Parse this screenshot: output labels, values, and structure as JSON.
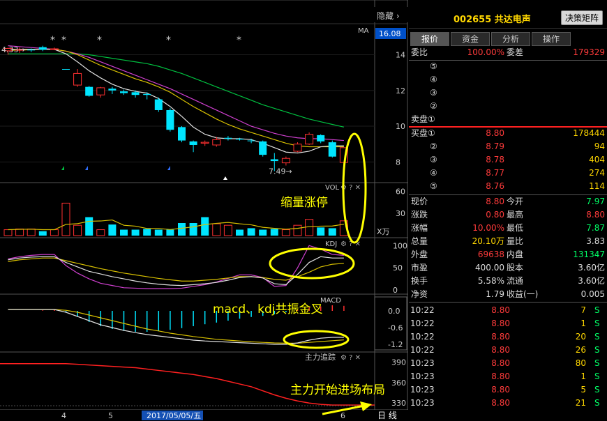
{
  "toolbar": {
    "hide_label": "隐藏",
    "hide_arrow": "›"
  },
  "stock": {
    "code_name": "002655 共达电声",
    "decision_button": "决策矩阵"
  },
  "tabs": [
    "报价",
    "资金",
    "分析",
    "操作"
  ],
  "quote": {
    "weibi_label": "委比",
    "weibi": "100.00%",
    "weicha_label": "委差",
    "weicha": "179329",
    "sell_header": "卖盘①",
    "sell_levels": [
      "⑤",
      "④",
      "③",
      "②"
    ],
    "buy_header": "买盘①",
    "buy": [
      {
        "level": "①",
        "price": "8.80",
        "vol": "178444"
      },
      {
        "level": "②",
        "price": "8.79",
        "vol": "94"
      },
      {
        "level": "③",
        "price": "8.78",
        "vol": "404"
      },
      {
        "level": "④",
        "price": "8.77",
        "vol": "274"
      },
      {
        "level": "⑤",
        "price": "8.76",
        "vol": "114"
      }
    ],
    "stats": [
      {
        "l1": "现价",
        "v1": "8.80",
        "c1": "red",
        "l2": "今开",
        "v2": "7.97",
        "c2": "grn"
      },
      {
        "l1": "涨跌",
        "v1": "0.80",
        "c1": "red",
        "l2": "最高",
        "v2": "8.80",
        "c2": "red"
      },
      {
        "l1": "涨幅",
        "v1": "10.00%",
        "c1": "red",
        "l2": "最低",
        "v2": "7.87",
        "c2": "grn"
      },
      {
        "l1": "总量",
        "v1": "20.10万",
        "c1": "yel",
        "l2": "量比",
        "v2": "3.83",
        "c2": "wht"
      },
      {
        "l1": "外盘",
        "v1": "69638",
        "c1": "red",
        "l2": "内盘",
        "v2": "131347",
        "c2": "grn"
      },
      {
        "l1": "市盈",
        "v1": "400.00",
        "c1": "wht",
        "l2": "股本",
        "v2": "3.60亿",
        "c2": "wht"
      },
      {
        "l1": "换手",
        "v1": "5.58%",
        "c1": "wht",
        "l2": "流通",
        "v2": "3.60亿",
        "c2": "wht"
      },
      {
        "l1": "净资",
        "v1": "1.79",
        "c1": "wht",
        "l2": "收益(一)",
        "v2": "0.005",
        "c2": "wht"
      }
    ],
    "ticks": [
      {
        "time": "10:22",
        "price": "8.80",
        "vol": "7",
        "side": "S"
      },
      {
        "time": "10:22",
        "price": "8.80",
        "vol": "1",
        "side": "S"
      },
      {
        "time": "10:22",
        "price": "8.80",
        "vol": "20",
        "side": "S"
      },
      {
        "time": "10:22",
        "price": "8.80",
        "vol": "26",
        "side": "S"
      },
      {
        "time": "10:23",
        "price": "8.80",
        "vol": "80",
        "side": "S"
      },
      {
        "time": "10:23",
        "price": "8.80",
        "vol": "1",
        "side": "S"
      },
      {
        "time": "10:23",
        "price": "8.80",
        "vol": "5",
        "side": "S"
      },
      {
        "time": "10:23",
        "price": "8.80",
        "vol": "21",
        "side": "S"
      }
    ]
  },
  "annotations": {
    "vol": "缩量涨停",
    "macd": "macd、kdj共振金叉",
    "main": "主力开始进场布局"
  },
  "chart_data": [
    {
      "type": "candlestick",
      "panel": "price",
      "ma_label": "MA",
      "current_price_tag": "16.08",
      "yticks": [
        "14",
        "12",
        "10",
        "8"
      ],
      "ylim": [
        7.0,
        15.5
      ],
      "high_label": "4.33→",
      "low_label": "7.49→",
      "candles": [
        {
          "o": 14.22,
          "c": 14.35,
          "h": 14.4,
          "l": 14.0,
          "up": true
        },
        {
          "o": 14.25,
          "c": 14.3,
          "h": 14.4,
          "l": 14.1,
          "up": true
        },
        {
          "o": 14.28,
          "c": 14.25,
          "h": 14.35,
          "l": 14.15,
          "up": false
        },
        {
          "o": 14.28,
          "c": 14.42,
          "h": 14.5,
          "l": 14.2,
          "up": false
        },
        {
          "o": 14.3,
          "c": 14.33,
          "h": 14.4,
          "l": 14.25,
          "up": true
        },
        {
          "o": 13.2,
          "c": 13.2,
          "h": 13.2,
          "l": 13.2,
          "up": false
        },
        {
          "o": 12.3,
          "c": 12.95,
          "h": 13.2,
          "l": 12.2,
          "up": true
        },
        {
          "o": 12.2,
          "c": 11.7,
          "h": 12.25,
          "l": 11.65,
          "up": false
        },
        {
          "o": 11.75,
          "c": 12.15,
          "h": 12.2,
          "l": 11.6,
          "up": true
        },
        {
          "o": 12.1,
          "c": 12.0,
          "h": 12.2,
          "l": 11.8,
          "up": false
        },
        {
          "o": 11.95,
          "c": 11.85,
          "h": 12.05,
          "l": 11.75,
          "up": false
        },
        {
          "o": 11.9,
          "c": 11.75,
          "h": 12.0,
          "l": 11.6,
          "up": false
        },
        {
          "o": 11.8,
          "c": 11.75,
          "h": 11.9,
          "l": 11.5,
          "up": false
        },
        {
          "o": 11.5,
          "c": 10.9,
          "h": 11.6,
          "l": 10.8,
          "up": false
        },
        {
          "o": 10.9,
          "c": 9.8,
          "h": 11.0,
          "l": 9.7,
          "up": false
        },
        {
          "o": 9.95,
          "c": 9.2,
          "h": 10.0,
          "l": 9.1,
          "up": false
        },
        {
          "o": 9.15,
          "c": 8.95,
          "h": 9.2,
          "l": 8.55,
          "up": false
        },
        {
          "o": 9.05,
          "c": 9.1,
          "h": 9.2,
          "l": 8.9,
          "up": true
        },
        {
          "o": 8.95,
          "c": 9.25,
          "h": 9.4,
          "l": 8.85,
          "up": true
        },
        {
          "o": 9.3,
          "c": 9.35,
          "h": 9.45,
          "l": 9.2,
          "up": false
        },
        {
          "o": 9.3,
          "c": 9.25,
          "h": 9.35,
          "l": 9.2,
          "up": false
        },
        {
          "o": 9.2,
          "c": 9.2,
          "h": 9.3,
          "l": 9.05,
          "up": false
        },
        {
          "o": 9.15,
          "c": 8.4,
          "h": 9.2,
          "l": 8.3,
          "up": false
        },
        {
          "o": 8.15,
          "c": 8.05,
          "h": 8.5,
          "l": 7.49,
          "up": false
        },
        {
          "o": 7.95,
          "c": 8.2,
          "h": 8.3,
          "l": 7.8,
          "up": true
        },
        {
          "o": 8.6,
          "c": 9.0,
          "h": 9.1,
          "l": 8.55,
          "up": true
        },
        {
          "o": 9.0,
          "c": 9.55,
          "h": 9.65,
          "l": 8.95,
          "up": true
        },
        {
          "o": 9.5,
          "c": 9.15,
          "h": 9.55,
          "l": 9.05,
          "up": false
        },
        {
          "o": 9.1,
          "c": 8.3,
          "h": 9.2,
          "l": 8.25,
          "up": false
        },
        {
          "o": 7.97,
          "c": 8.8,
          "h": 8.8,
          "l": 7.87,
          "up": true
        }
      ],
      "ma_white": [
        14.3,
        14.3,
        14.3,
        14.3,
        14.3,
        14.05,
        13.6,
        13.1,
        12.7,
        12.35,
        12.1,
        11.95,
        11.85,
        11.55,
        11.1,
        10.55,
        9.95,
        9.55,
        9.35,
        9.3,
        9.3,
        9.25,
        9.05,
        8.8,
        8.55,
        8.5,
        8.6,
        8.85,
        8.9,
        8.9
      ],
      "ma_yellow": [
        14.25,
        14.25,
        14.28,
        14.3,
        14.3,
        14.2,
        14.0,
        13.7,
        13.4,
        13.15,
        12.9,
        12.65,
        12.45,
        12.2,
        11.9,
        11.5,
        11.1,
        10.75,
        10.4,
        10.1,
        9.85,
        9.65,
        9.45,
        9.25,
        9.05,
        8.9,
        8.85,
        8.85,
        8.85,
        8.85
      ],
      "ma_green": [
        14.05,
        14.05,
        14.05,
        14.05,
        14.05,
        14.05,
        14.05,
        14.0,
        13.9,
        13.8,
        13.7,
        13.6,
        13.5,
        13.35,
        13.15,
        12.95,
        12.7,
        12.45,
        12.2,
        11.95,
        11.7,
        11.45,
        11.2,
        11.0,
        10.8,
        10.6,
        10.4,
        10.25,
        10.1,
        9.95
      ],
      "ma_magenta": [
        14.5,
        14.45,
        14.4,
        14.35,
        14.3,
        14.2,
        14.05,
        13.85,
        13.6,
        13.35,
        13.1,
        12.85,
        12.6,
        12.35,
        12.1,
        11.8,
        11.5,
        11.2,
        10.9,
        10.6,
        10.3,
        10.0,
        9.8,
        9.6,
        9.45,
        9.35,
        9.3,
        9.3,
        9.25,
        9.2
      ]
    },
    {
      "type": "bar",
      "panel": "volume",
      "label": "VOL",
      "yticks": [
        "60",
        "30"
      ],
      "unit": "X万",
      "ylim": [
        0,
        68
      ],
      "values": [
        8,
        9,
        9,
        6,
        8,
        44,
        14,
        25,
        8,
        15,
        8,
        8,
        9,
        8,
        8,
        17,
        17,
        25,
        16,
        14,
        8,
        10,
        8,
        9,
        8,
        14,
        22,
        11,
        10,
        20
      ],
      "up": [
        true,
        true,
        true,
        false,
        true,
        true,
        true,
        false,
        true,
        false,
        false,
        false,
        false,
        false,
        false,
        false,
        false,
        false,
        true,
        true,
        false,
        false,
        false,
        false,
        true,
        true,
        true,
        false,
        false,
        true
      ]
    },
    {
      "type": "line",
      "panel": "kdj",
      "label": "KDJ",
      "yticks": [
        "100",
        "50",
        "0"
      ],
      "ylim": [
        0,
        110
      ],
      "k": [
        68,
        72,
        74,
        75,
        75,
        62,
        52,
        42,
        36,
        30,
        25,
        20,
        16,
        13,
        11,
        10,
        12,
        14,
        17,
        22,
        28,
        30,
        27,
        14,
        12,
        35,
        62,
        75,
        72,
        72
      ],
      "d": [
        64,
        68,
        70,
        72,
        72,
        66,
        60,
        54,
        48,
        43,
        38,
        34,
        30,
        26,
        23,
        20,
        20,
        22,
        24,
        27,
        30,
        30,
        28,
        24,
        22,
        30,
        40,
        52,
        58,
        60
      ],
      "j": [
        70,
        75,
        78,
        80,
        80,
        55,
        38,
        25,
        15,
        10,
        5,
        4,
        3,
        3,
        3,
        4,
        8,
        12,
        18,
        26,
        34,
        34,
        28,
        8,
        10,
        50,
        100,
        92,
        80,
        78
      ]
    },
    {
      "type": "bar",
      "panel": "macd",
      "label": "MACD",
      "yticks": [
        "0.0",
        "-0.6",
        "-1.2"
      ],
      "ylim": [
        -1.4,
        0.5
      ],
      "hist": [
        0,
        0,
        0,
        0.02,
        0.05,
        -0.05,
        -0.2,
        -0.4,
        -0.55,
        -0.65,
        -0.72,
        -0.75,
        -0.75,
        -0.72,
        -0.68,
        -0.62,
        -0.55,
        -0.48,
        -0.42,
        -0.35,
        -0.28,
        -0.22,
        -0.18,
        -0.12,
        -0.05,
        0.04,
        0.12,
        0.16,
        0.2,
        0.18
      ],
      "dif": [
        0.05,
        0.05,
        0.05,
        0.05,
        0.05,
        -0.05,
        -0.2,
        -0.35,
        -0.5,
        -0.6,
        -0.7,
        -0.78,
        -0.85,
        -0.9,
        -0.95,
        -1.0,
        -1.05,
        -1.08,
        -1.1,
        -1.12,
        -1.14,
        -1.16,
        -1.18,
        -1.2,
        -1.2,
        -1.15,
        -1.05,
        -0.98,
        -0.95,
        -0.95
      ],
      "dea": [
        0.05,
        0.05,
        0.05,
        0.05,
        0.05,
        0.02,
        -0.05,
        -0.15,
        -0.25,
        -0.35,
        -0.45,
        -0.55,
        -0.65,
        -0.72,
        -0.8,
        -0.86,
        -0.92,
        -0.97,
        -1.02,
        -1.05,
        -1.08,
        -1.11,
        -1.13,
        -1.15,
        -1.16,
        -1.16,
        -1.13,
        -1.1,
        -1.07,
        -1.04
      ]
    },
    {
      "type": "line",
      "panel": "main-force",
      "label": "主力追踪",
      "yticks": [
        "390",
        "360",
        "330"
      ],
      "ylim": [
        322,
        400
      ],
      "red": [
        388,
        388,
        388,
        388,
        388,
        388,
        387,
        386,
        385,
        384,
        383,
        382,
        380,
        378,
        376,
        374,
        372,
        369,
        366,
        362,
        358,
        354,
        348,
        342,
        337,
        333,
        330,
        328,
        327,
        327
      ],
      "white": [
        388,
        388,
        388,
        388,
        388,
        388,
        387,
        386,
        385,
        384,
        383,
        382,
        380,
        378,
        376,
        374,
        372,
        369,
        366,
        362,
        358,
        354,
        348,
        342,
        337,
        333,
        330,
        328,
        327,
        327
      ]
    }
  ],
  "xaxis": {
    "labels": [
      "4",
      "5",
      "2017/05/05/五",
      "6"
    ],
    "period": "日 线"
  }
}
